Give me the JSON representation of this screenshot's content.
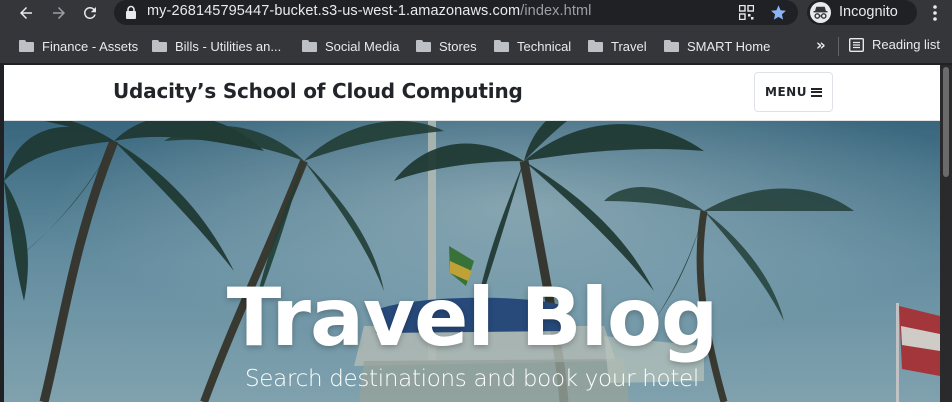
{
  "browser": {
    "url_host": "my-268145795447-bucket.s3-us-west-1.amazonaws.com",
    "url_path": "/index.html",
    "profile_label": "Incognito",
    "bookmarks": [
      {
        "label": "Finance - Assets"
      },
      {
        "label": "Bills - Utilities an..."
      },
      {
        "label": "Social Media"
      },
      {
        "label": "Stores"
      },
      {
        "label": "Technical"
      },
      {
        "label": "Travel"
      },
      {
        "label": "SMART Home"
      }
    ],
    "more_bookmarks": "»",
    "reading_list_label": "Reading list",
    "icons": {
      "back": "back-arrow-icon",
      "forward": "forward-arrow-icon",
      "reload": "reload-icon",
      "lock": "lock-icon",
      "apps": "qr-code-icon",
      "bookmark_star": "star-icon",
      "incognito": "incognito-icon",
      "menu": "kebab-menu-icon"
    },
    "colors": {
      "star": "#8ab4f8",
      "toolbar": "#35363a",
      "omnibox": "#202124"
    }
  },
  "site": {
    "brand": "Udacity’s School of Cloud Computing",
    "menu_label": "MENU",
    "hero": {
      "title": "Travel Blog",
      "subtitle": "Search destinations and book your hotel"
    }
  }
}
